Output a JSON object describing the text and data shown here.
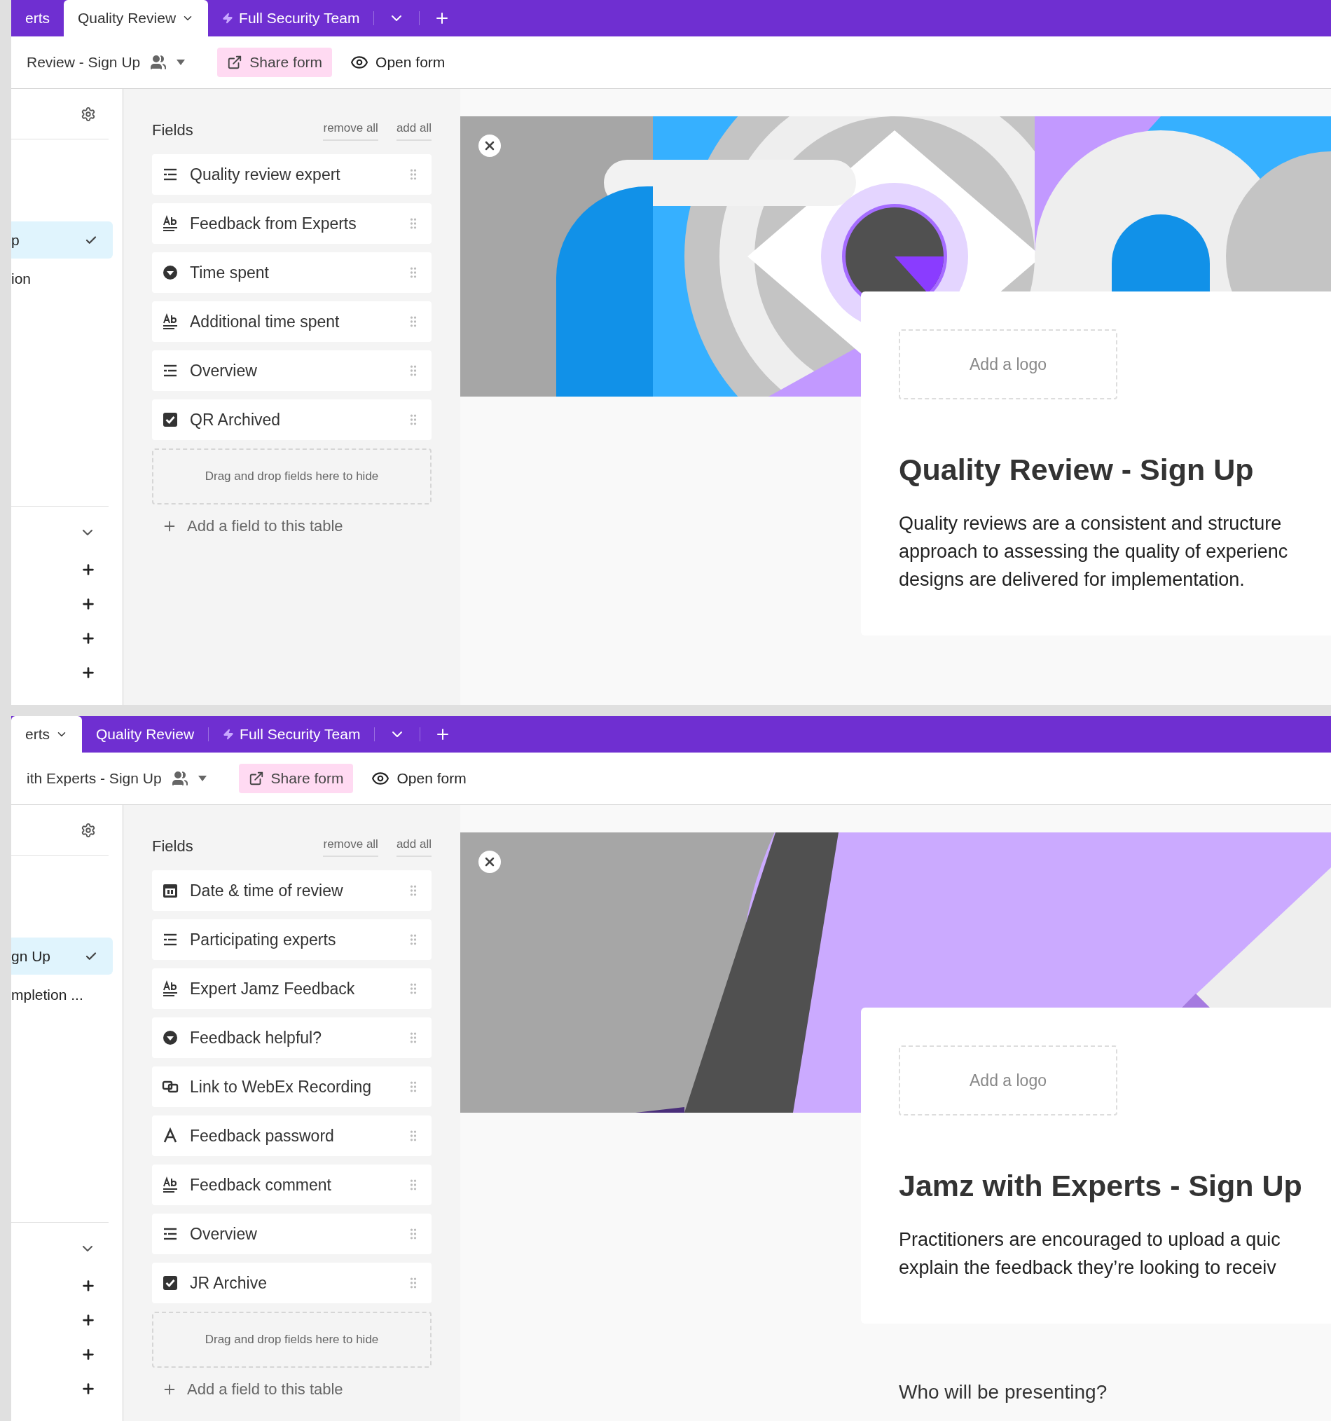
{
  "panels": [
    {
      "tabs": [
        {
          "label": "erts",
          "selected": false,
          "kind": "plain"
        },
        {
          "label": "Quality Review",
          "selected": true,
          "kind": "plain"
        },
        {
          "label": "Full Security Team",
          "selected": false,
          "kind": "bolt"
        }
      ],
      "toolbar": {
        "title": "Review - Sign Up",
        "share": "Share form",
        "open": "Open form"
      },
      "sidebar": {
        "items": [
          {
            "label": "p",
            "selected": true
          },
          {
            "label": "ion",
            "selected": false
          }
        ]
      },
      "fields": {
        "title": "Fields",
        "remove_all": "remove all",
        "add_all": "add all",
        "items": [
          {
            "label": "Quality review expert",
            "kind": "lines"
          },
          {
            "label": "Feedback from Experts",
            "kind": "text"
          },
          {
            "label": "Time spent",
            "kind": "select"
          },
          {
            "label": "Additional time spent",
            "kind": "text"
          },
          {
            "label": "Overview",
            "kind": "lines"
          },
          {
            "label": "QR Archived",
            "kind": "checkbox"
          }
        ],
        "drop_hint": "Drag and drop fields here to hide",
        "add_field": "Add a field to this table"
      },
      "form": {
        "logo": "Add a logo",
        "title": "Quality Review - Sign Up",
        "description": [
          "Quality reviews are a consistent and structure",
          "approach to assessing the quality of experienc",
          "designs are delivered for implementation."
        ]
      }
    },
    {
      "tabs": [
        {
          "label": "erts",
          "selected": true,
          "kind": "plain"
        },
        {
          "label": "Quality Review",
          "selected": false,
          "kind": "plain"
        },
        {
          "label": "Full Security Team",
          "selected": false,
          "kind": "bolt"
        }
      ],
      "toolbar": {
        "title": "ith Experts - Sign Up",
        "share": "Share form",
        "open": "Open form"
      },
      "sidebar": {
        "items": [
          {
            "label": "gn Up",
            "selected": true
          },
          {
            "label": "mpletion ...",
            "selected": false
          }
        ]
      },
      "fields": {
        "title": "Fields",
        "remove_all": "remove all",
        "add_all": "add all",
        "items": [
          {
            "label": "Date & time of review",
            "kind": "date"
          },
          {
            "label": "Participating experts",
            "kind": "lines"
          },
          {
            "label": "Expert Jamz Feedback",
            "kind": "text"
          },
          {
            "label": "Feedback helpful?",
            "kind": "select"
          },
          {
            "label": "Link to WebEx Recording",
            "kind": "link"
          },
          {
            "label": "Feedback password",
            "kind": "letter"
          },
          {
            "label": "Feedback comment",
            "kind": "text"
          },
          {
            "label": "Overview",
            "kind": "lines"
          },
          {
            "label": "JR Archive",
            "kind": "checkbox"
          }
        ],
        "drop_hint": "Drag and drop fields here to hide",
        "add_field": "Add a field to this table"
      },
      "form": {
        "logo": "Add a logo",
        "title": "Jamz with Experts - Sign Up",
        "description": [
          "Practitioners are encouraged to upload a quic",
          "explain the feedback they’re looking to receiv"
        ],
        "question": "Who will be presenting?"
      }
    }
  ]
}
